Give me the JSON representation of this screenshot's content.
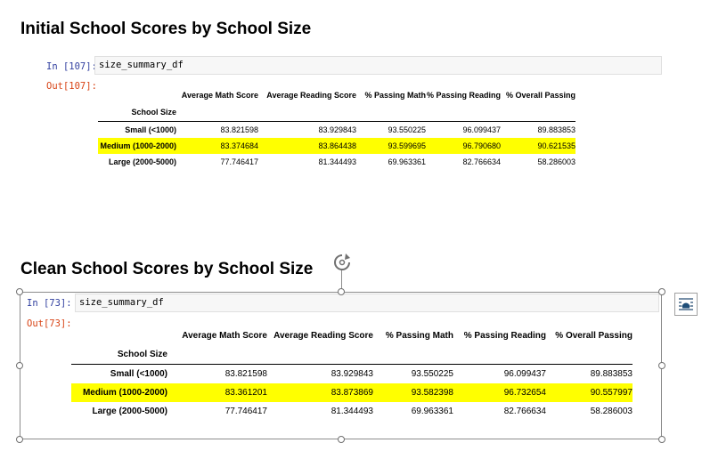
{
  "headings": {
    "initial": "Initial School Scores by School Size",
    "clean": "Clean School Scores by School Size"
  },
  "top_cell": {
    "in_prompt": "In [107]:",
    "code": "size_summary_df",
    "out_prompt": "Out[107]:"
  },
  "bottom_cell": {
    "in_prompt": "In [73]:",
    "code": "size_summary_df",
    "out_prompt": "Out[73]:"
  },
  "columns": [
    "Average Math Score",
    "Average Reading Score",
    "% Passing Math",
    "% Passing Reading",
    "% Overall Passing"
  ],
  "index_name": "School Size",
  "initial_table": {
    "rows": [
      {
        "label": "Small (<1000)",
        "values": [
          "83.821598",
          "83.929843",
          "93.550225",
          "96.099437",
          "89.883853"
        ]
      },
      {
        "label": "Medium (1000-2000)",
        "values": [
          "83.374684",
          "83.864438",
          "93.599695",
          "96.790680",
          "90.621535"
        ]
      },
      {
        "label": "Large (2000-5000)",
        "values": [
          "77.746417",
          "81.344493",
          "69.963361",
          "82.766634",
          "58.286003"
        ]
      }
    ]
  },
  "clean_table": {
    "rows": [
      {
        "label": "Small (<1000)",
        "values": [
          "83.821598",
          "83.929843",
          "93.550225",
          "96.099437",
          "89.883853"
        ]
      },
      {
        "label": "Medium (1000-2000)",
        "values": [
          "83.361201",
          "83.873869",
          "93.582398",
          "96.732654",
          "90.557997"
        ]
      },
      {
        "label": "Large (2000-5000)",
        "values": [
          "77.746417",
          "81.344493",
          "69.963361",
          "82.766634",
          "58.286003"
        ]
      }
    ]
  },
  "highlight_color": "#ffff00",
  "icons": {
    "rotate": "rotate-handle-icon",
    "layout": "layout-options-icon"
  }
}
